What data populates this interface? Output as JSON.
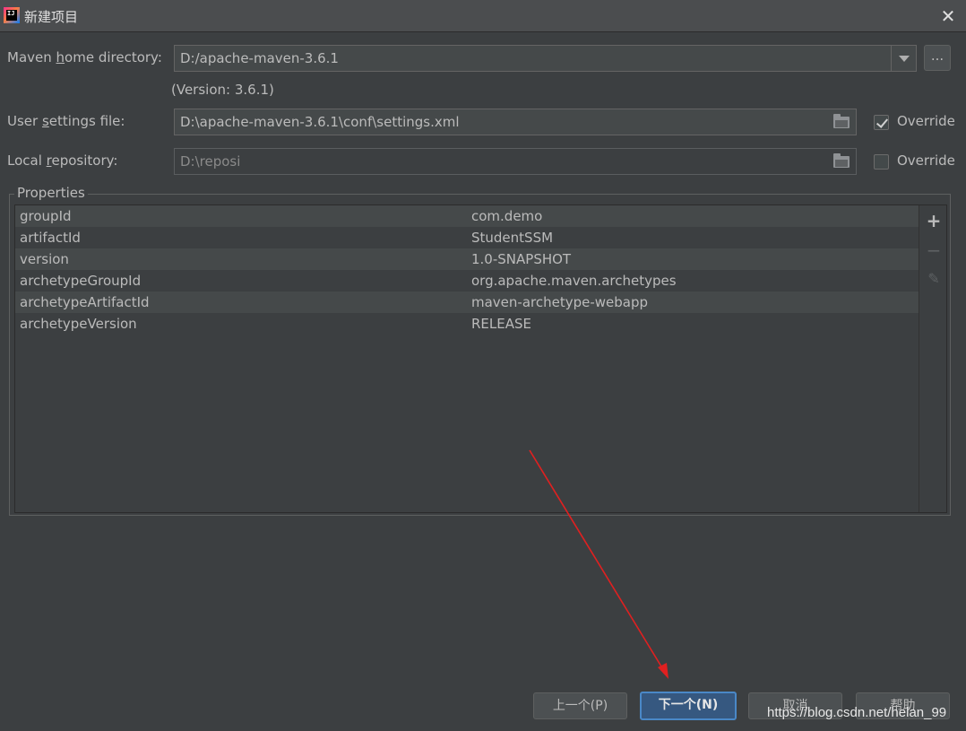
{
  "window": {
    "title": "新建项目",
    "logo_text": "IJ"
  },
  "maven_home": {
    "label_pre": "Maven ",
    "label_mnemonic": "h",
    "label_post": "ome directory:",
    "value": "D:/apache-maven-3.6.1",
    "browse_label": "...",
    "version_note": "(Version: 3.6.1)"
  },
  "user_settings": {
    "label_pre": "User ",
    "label_mnemonic": "s",
    "label_post": "ettings file:",
    "value": "D:\\apache-maven-3.6.1\\conf\\settings.xml",
    "override_label": "Override",
    "override_checked": true
  },
  "local_repo": {
    "label_pre": "Local ",
    "label_mnemonic": "r",
    "label_post": "epository:",
    "value": "D:\\reposi",
    "override_label": "Override",
    "override_checked": false
  },
  "properties": {
    "title": "Properties",
    "rows": [
      {
        "key": "groupId",
        "value": "com.demo"
      },
      {
        "key": "artifactId",
        "value": "StudentSSM"
      },
      {
        "key": "version",
        "value": "1.0-SNAPSHOT"
      },
      {
        "key": "archetypeGroupId",
        "value": "org.apache.maven.archetypes"
      },
      {
        "key": "archetypeArtifactId",
        "value": "maven-archetype-webapp"
      },
      {
        "key": "archetypeVersion",
        "value": "RELEASE"
      }
    ],
    "actions": {
      "add_icon": "plus-icon",
      "remove_icon": "minus-icon",
      "edit_icon": "pencil-icon"
    }
  },
  "buttons": {
    "previous": "上一个(P)",
    "next": "下一个(N)",
    "cancel": "取消",
    "help": "帮助"
  },
  "watermark": "https://blog.csdn.net/helan_99",
  "colors": {
    "background": "#3c3f41",
    "primary_button": "#365880",
    "annotation_arrow": "#e02020"
  }
}
